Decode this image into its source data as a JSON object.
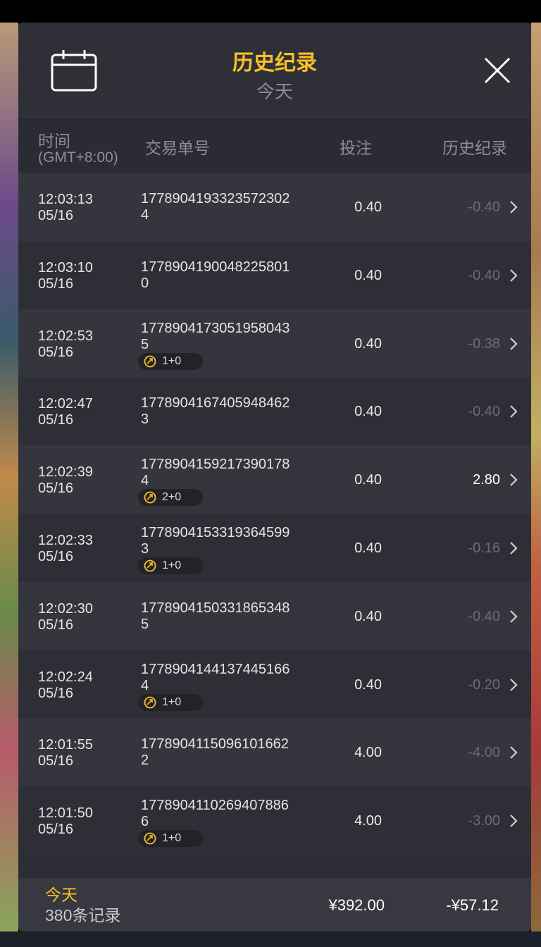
{
  "header": {
    "title": "历史纪录",
    "subtitle": "今天",
    "calendar_icon": "calendar-icon",
    "close_icon": "close-icon"
  },
  "columns": {
    "time": "时间",
    "timezone": "(GMT+8:00)",
    "transaction": "交易单号",
    "bet": "投注",
    "history": "历史纪录"
  },
  "rows": [
    {
      "time": "12:03:13",
      "date": "05/16",
      "txn": "17789041933235723024",
      "bet": "0.40",
      "win": "-0.40",
      "badge": null
    },
    {
      "time": "12:03:10",
      "date": "05/16",
      "txn": "17789041900482258010",
      "bet": "0.40",
      "win": "-0.40",
      "badge": null
    },
    {
      "time": "12:02:53",
      "date": "05/16",
      "txn": "17789041730519580435",
      "bet": "0.40",
      "win": "-0.38",
      "badge": "1+0"
    },
    {
      "time": "12:02:47",
      "date": "05/16",
      "txn": "17789041674059484623",
      "bet": "0.40",
      "win": "-0.40",
      "badge": null
    },
    {
      "time": "12:02:39",
      "date": "05/16",
      "txn": "17789041592173901784",
      "bet": "0.40",
      "win": "2.80",
      "badge": "2+0",
      "positive": true
    },
    {
      "time": "12:02:33",
      "date": "05/16",
      "txn": "17789041533193645993",
      "bet": "0.40",
      "win": "-0.16",
      "badge": "1+0"
    },
    {
      "time": "12:02:30",
      "date": "05/16",
      "txn": "17789041503318653485",
      "bet": "0.40",
      "win": "-0.40",
      "badge": null
    },
    {
      "time": "12:02:24",
      "date": "05/16",
      "txn": "17789041441374451664",
      "bet": "0.40",
      "win": "-0.20",
      "badge": "1+0"
    },
    {
      "time": "12:01:55",
      "date": "05/16",
      "txn": "17789041150961016622",
      "bet": "4.00",
      "win": "-4.00",
      "badge": null
    },
    {
      "time": "12:01:50",
      "date": "05/16",
      "txn": "17789041102694078866",
      "bet": "4.00",
      "win": "-3.00",
      "badge": "1+0"
    }
  ],
  "footer": {
    "period": "今天",
    "count": "380条记录",
    "total_bet": "¥392.00",
    "total_win": "-¥57.12"
  },
  "colors": {
    "accent": "#f5c228",
    "panel": "#2d2d36",
    "negative_text": "#6c6c76",
    "positive_text": "#ffffff"
  }
}
